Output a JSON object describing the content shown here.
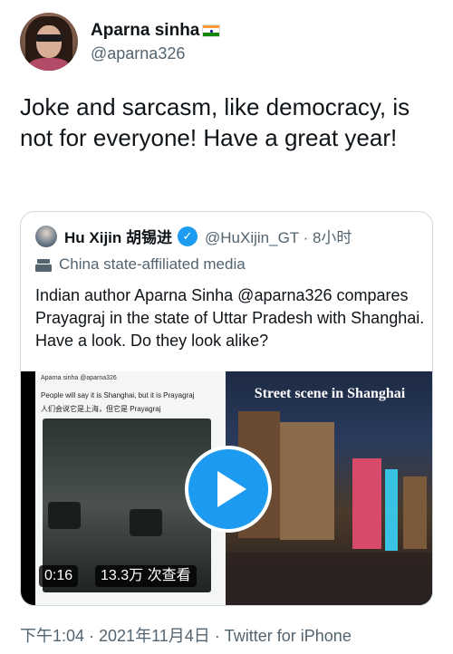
{
  "author": {
    "display_name": "Aparna sinha",
    "handle": "@aparna326"
  },
  "tweet": {
    "text": "Joke and sarcasm, like democracy, is not for everyone! Have a great year!"
  },
  "quote": {
    "display_name": "Hu Xijin 胡锡进",
    "handle_time": "@HuXijin_GT · 8小时",
    "affiliation": "China state-affiliated media",
    "text": "Indian author Aparna Sinha @aparna326 compares Prayagraj in the state of Uttar Pradesh with Shanghai. Have a look. Do they look alike?",
    "media": {
      "left_panel": {
        "name": "Aparna sinha",
        "handle": "@aparna326",
        "caption_en": "People will say it is Shanghai, but it is Prayagraj",
        "caption_zh": "人们会说它是上海，但它是 Prayagraj"
      },
      "right_panel": {
        "title": "Street scene in Shanghai"
      },
      "duration": "0:16",
      "views": "13.3万 次查看"
    }
  },
  "footer": {
    "meta": "下午1:04 · 2021年11月4日 · Twitter for iPhone"
  },
  "colors": {
    "accent": "#1d9bf0",
    "text": "#0f1419",
    "muted": "#536471",
    "border": "#cfd9de"
  },
  "icons": {
    "verified": "verified-check-icon",
    "affiliation": "podium-icon",
    "flag": "india-flag-icon",
    "play": "play-icon"
  }
}
